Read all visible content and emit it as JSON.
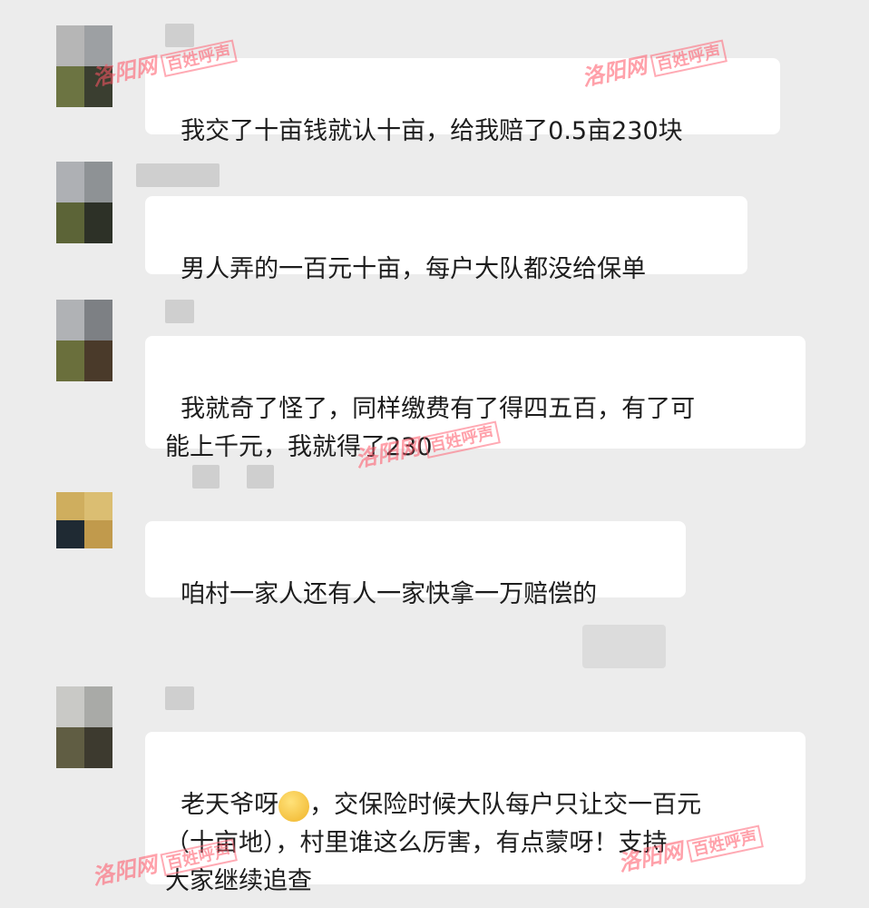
{
  "messages": [
    {
      "text": "我交了十亩钱就认十亩，给我赔了0.5亩230块"
    },
    {
      "text": "男人弄的一百元十亩，每户大队都没给保单"
    },
    {
      "text": "我就奇了怪了，同样缴费有了得四五百，有了可\n能上千元，我就得了230"
    },
    {
      "text": "咱村一家人还有人一家快拿一万赔偿的"
    },
    {
      "text_before": "老天爷呀",
      "text_after": "，交保险时候大队每户只让交一百元\n（十亩地），村里谁这么厉害，有点蒙呀！支持\n大家继续追查"
    }
  ],
  "watermark": {
    "brand": "洛阳网",
    "tag": "百姓呼声"
  }
}
